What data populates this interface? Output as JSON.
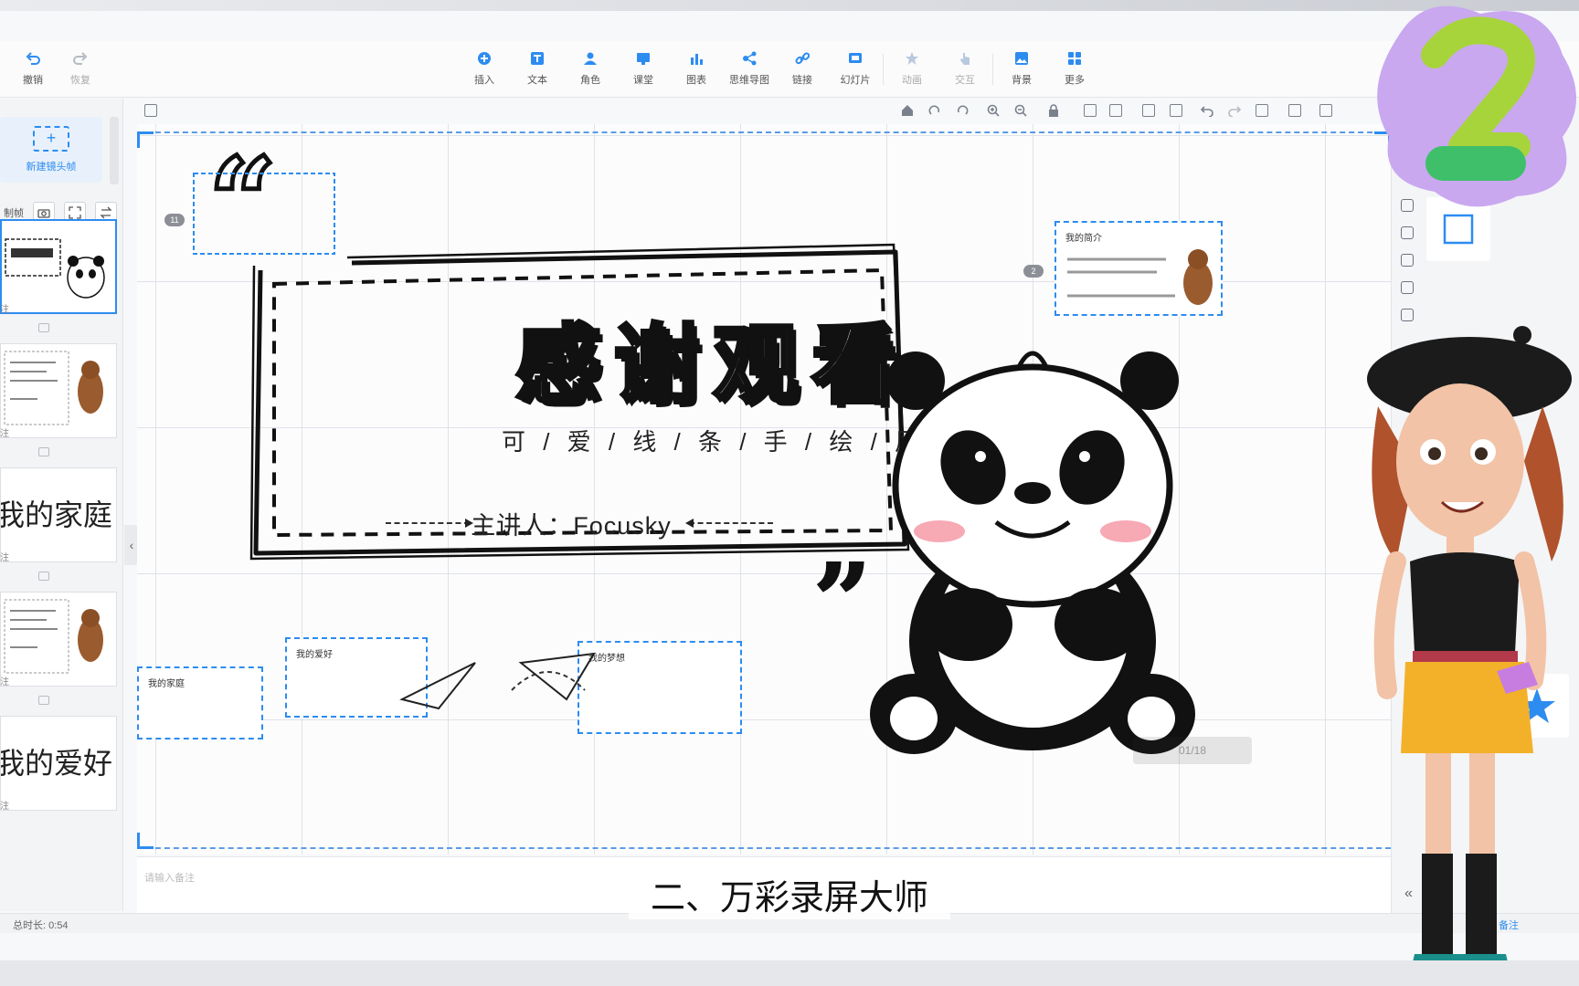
{
  "toolbar": {
    "undo": "撤销",
    "redo": "恢复",
    "insert": "插入",
    "text": "文本",
    "role": "角色",
    "classroom": "课堂",
    "chart": "图表",
    "mindmap": "思维导图",
    "link": "链接",
    "slide": "幻灯片",
    "animation": "动画",
    "interaction": "交互",
    "background": "背景",
    "more": "更多"
  },
  "left_panel": {
    "new_frame": "新建镜头帧",
    "record_frame": "制帧",
    "note_label": "注",
    "thumbs": [
      {
        "text": ""
      },
      {
        "text": ""
      },
      {
        "text": "我的家庭"
      },
      {
        "text": ""
      },
      {
        "text": "我的爱好"
      }
    ]
  },
  "slide": {
    "title": "感谢观看",
    "subtitle": "可 / 爱 / 线 /  条 / 手 /  绘 / 风",
    "presenter": "主讲人：Focusky",
    "cards": [
      {
        "title": "我的简介",
        "badge": "2"
      },
      {
        "title": "我的家庭",
        "badge": ""
      },
      {
        "title": "我的爱好",
        "badge": ""
      },
      {
        "title": "我的梦想",
        "badge": ""
      }
    ],
    "frame_badge": "11",
    "counter": "01/18"
  },
  "notes": {
    "placeholder": "请输入备注"
  },
  "status": {
    "duration": "总时长: 0:54",
    "notes_button": "备注"
  },
  "overlay": {
    "subtitle": "二、万彩录屏大师",
    "watermark_number": "2"
  },
  "colors": {
    "accent": "#2d8cf0",
    "watermark_purple": "#c9a8f0",
    "watermark_green": "#3fbf6a",
    "watermark_yellowgreen": "#a7d43a"
  }
}
